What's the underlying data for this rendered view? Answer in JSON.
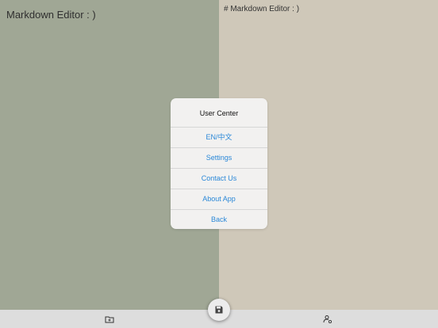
{
  "preview": {
    "title": "Markdown Editor : )"
  },
  "source": {
    "text": "# Markdown Editor : )"
  },
  "dialog": {
    "title": "User Center",
    "items": [
      {
        "label": "EN/中文"
      },
      {
        "label": "Settings"
      },
      {
        "label": "Contact Us"
      },
      {
        "label": "About App"
      },
      {
        "label": "Back"
      }
    ]
  },
  "bottom_bar": {
    "icons": [
      "folder-icon",
      "save-icon",
      "user-settings-icon"
    ]
  },
  "colors": {
    "preview_bg": "#a0a795",
    "source_bg": "#cfc8b9",
    "link_blue": "#2b88d8",
    "bar_bg": "#dddddd"
  }
}
